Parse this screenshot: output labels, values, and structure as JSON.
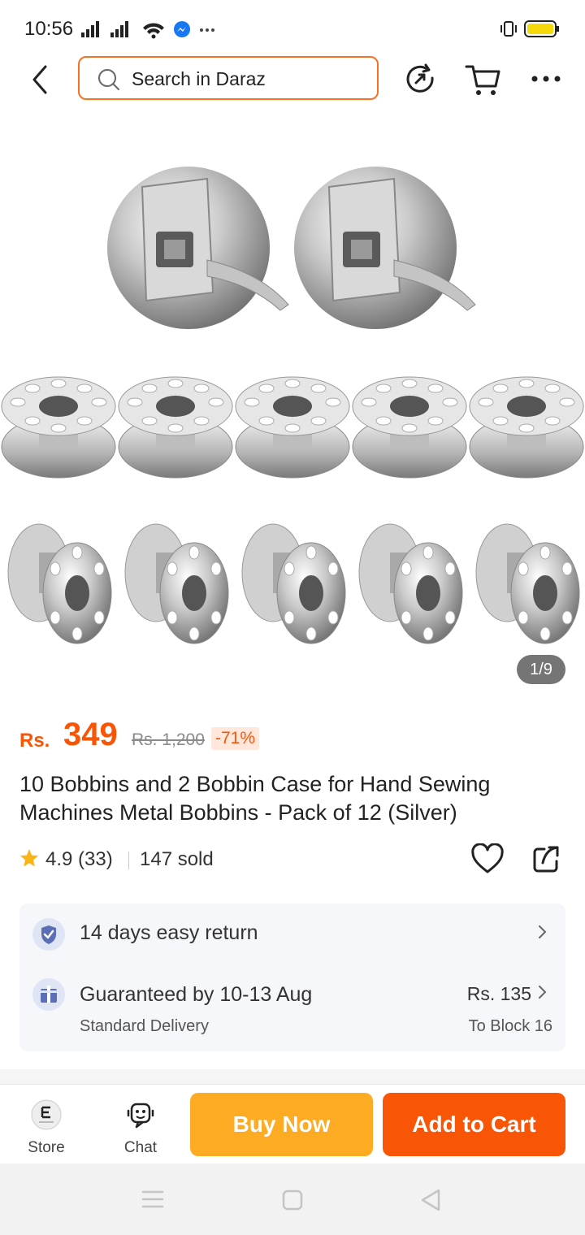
{
  "status_bar": {
    "time": "10:56"
  },
  "search": {
    "placeholder": "Search in Daraz"
  },
  "gallery": {
    "counter": "1/9"
  },
  "price": {
    "currency": "Rs.",
    "current": "349",
    "original": "Rs. 1,200",
    "discount": "-71%"
  },
  "product": {
    "title": "10 Bobbins and 2 Bobbin Case for Hand Sewing Machines Metal Bobbins - Pack of 12 (Silver)",
    "rating": "4.9 (33)",
    "sold": "147 sold"
  },
  "service": {
    "return": "14 days easy return",
    "delivery_title": "Guaranteed by 10-13 Aug",
    "delivery_type": "Standard Delivery",
    "delivery_fee": "Rs. 135",
    "delivery_to": "To Block 16"
  },
  "bottom_bar": {
    "store": "Store",
    "chat": "Chat",
    "buy_now": "Buy Now",
    "add_to_cart": "Add to Cart"
  },
  "colors": {
    "accent": "#f85606",
    "buy": "#fcab22",
    "search_border": "#f57224"
  }
}
